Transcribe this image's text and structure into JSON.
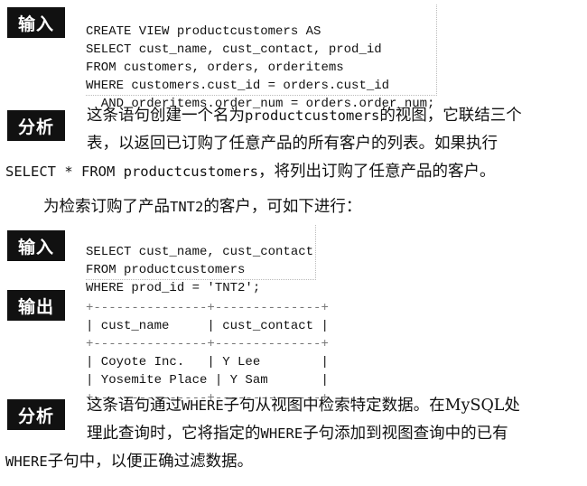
{
  "blocks": [
    {
      "tag": "输入",
      "code_lines": [
        "CREATE VIEW productcustomers AS",
        "SELECT cust_name, cust_contact, prod_id",
        "FROM customers, orders, orderitems",
        "WHERE customers.cust_id = orders.cust_id",
        "  AND orderitems.order_num = orders.order_num;"
      ]
    },
    {
      "tag": "分析",
      "text": {
        "p1_a": "这条语句创建一个名为",
        "p1_code": "productcustomers",
        "p1_b": "的视图，它联结三个",
        "p2": "表，以返回已订购了任意产品的所有客户的列表。如果执行",
        "p3_code": "SELECT * FROM productcustomers",
        "p3_b": "，将列出订购了任意产品的客户。"
      }
    },
    {
      "intro_a": "为检索订购了产品",
      "intro_code": "TNT2",
      "intro_b": "的客户，可如下进行："
    },
    {
      "tag": "输入",
      "code_lines": [
        "SELECT cust_name, cust_contact",
        "FROM productcustomers",
        "WHERE prod_id = 'TNT2';"
      ]
    },
    {
      "tag": "输出",
      "table": {
        "border": "+---------------+--------------+",
        "header": "| cust_name     | cust_contact |",
        "rows": [
          "| Coyote Inc.   | Y Lee        |",
          "| Yosemite Place | Y Sam       |"
        ]
      }
    },
    {
      "tag": "分析",
      "text": {
        "p1_a": "这条语句通过",
        "p1_code": "WHERE",
        "p1_b": "子句从视图中检索特定数据。在MySQL处",
        "p2_a": "理此查询时，它将指定的",
        "p2_code": "WHERE",
        "p2_b": "子句添加到视图查询中的已有",
        "p3_code": "WHERE",
        "p3_b": "子句中，以便正确过滤数据。"
      }
    }
  ]
}
